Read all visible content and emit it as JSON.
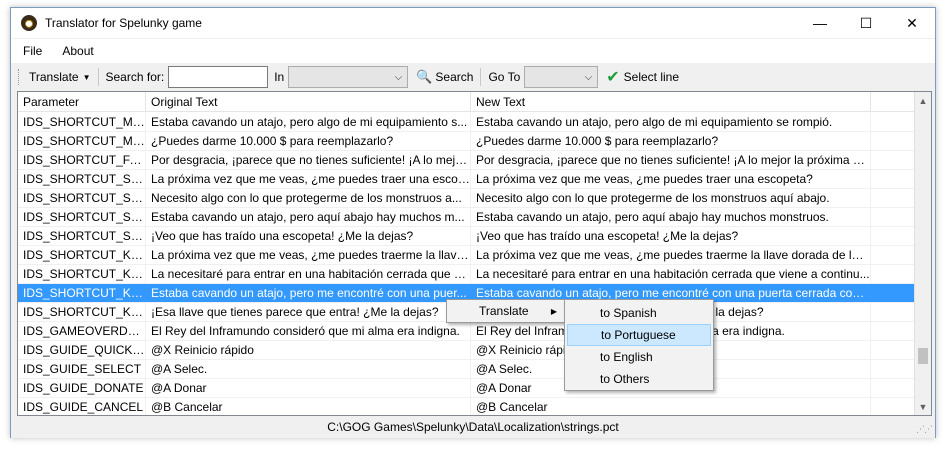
{
  "window": {
    "title": "Translator for Spelunky game"
  },
  "controls": {
    "minimize": "—",
    "maximize": "☐",
    "close": "✕"
  },
  "menu": {
    "file": "File",
    "about": "About"
  },
  "toolbar": {
    "translate_label": "Translate",
    "search_for_label": "Search for:",
    "search_value": "",
    "in_label": "In",
    "in_value": "",
    "search_button": "Search",
    "goto_label": "Go To",
    "goto_value": "",
    "select_line": "Select line"
  },
  "grid": {
    "columns": [
      "Parameter",
      "Original Text",
      "New Text"
    ],
    "rows": [
      {
        "param": "IDS_SHORTCUT_MO...",
        "orig": "Estaba cavando un atajo, pero algo de mi equipamiento s...",
        "new": "Estaba cavando un atajo, pero algo de mi equipamiento se rompió."
      },
      {
        "param": "IDS_SHORTCUT_MO...",
        "orig": "¿Puedes darme 10.000 $ para reemplazarlo?",
        "new": "¿Puedes darme 10.000 $ para reemplazarlo?"
      },
      {
        "param": "IDS_SHORTCUT_FAIL",
        "orig": "Por desgracia, ¡parece que no tienes suficiente! ¡A lo mejo...",
        "new": "Por desgracia, ¡parece que no tienes suficiente! ¡A lo mejor la próxima vez!"
      },
      {
        "param": "IDS_SHORTCUT_SHO...",
        "orig": "La próxima vez que me veas, ¿me puedes traer una escop...",
        "new": "La próxima vez que me veas, ¿me puedes traer una escopeta?"
      },
      {
        "param": "IDS_SHORTCUT_SHO...",
        "orig": "Necesito algo con lo que protegerme de los monstruos a...",
        "new": "Necesito algo con lo que protegerme de los monstruos aquí abajo."
      },
      {
        "param": "IDS_SHORTCUT_SHO...",
        "orig": "Estaba cavando un atajo, pero aquí abajo hay muchos m...",
        "new": "Estaba cavando un atajo, pero aquí abajo hay muchos monstruos."
      },
      {
        "param": "IDS_SHORTCUT_SHO...",
        "orig": "¡Veo que has traído una escopeta! ¿Me la dejas?",
        "new": "¡Veo que has traído una escopeta! ¿Me la dejas?"
      },
      {
        "param": "IDS_SHORTCUT_KEY_...",
        "orig": "La próxima vez que me veas, ¿me puedes traerme la llave dor...",
        "new": "La próxima vez que me veas, ¿me puedes traerme la llave dorada de las Min..."
      },
      {
        "param": "IDS_SHORTCUT_KEY_...",
        "orig": "La necesitaré para entrar en una habitación cerrada que vi...",
        "new": "La necesitaré para entrar en una habitación cerrada que viene a continu..."
      },
      {
        "param": "IDS_SHORTCUT_KEY",
        "orig": "Estaba cavando un atajo, pero me encontré con una puer...",
        "new": "Estaba cavando un atajo, pero me encontré con una puerta cerrada con ...",
        "selected": true
      },
      {
        "param": "IDS_SHORTCUT_KEY_...",
        "orig": "¡Esa llave que tienes parece que entra! ¿Me la dejas?",
        "new": "¡Esa llave que tienes parece que entra! ¿Me la dejas?"
      },
      {
        "param": "IDS_GAMEOVERDESC...",
        "orig": "El Rey del Inframundo consideró que mi alma era indigna.",
        "new": "El Rey del Inframundo consideró que mi alma era indigna."
      },
      {
        "param": "IDS_GUIDE_QUICKRE...",
        "orig": "@X Reinicio rápido",
        "new": "@X Reinicio rápido"
      },
      {
        "param": "IDS_GUIDE_SELECT",
        "orig": "@A Selec.",
        "new": "@A Selec."
      },
      {
        "param": "IDS_GUIDE_DONATE",
        "orig": "@A Donar",
        "new": "@A Donar"
      },
      {
        "param": "IDS_GUIDE_CANCEL",
        "orig": "@B Cancelar",
        "new": "@B Cancelar"
      }
    ]
  },
  "status": {
    "path": "C:\\GOG Games\\Spelunky\\Data\\Localization\\strings.pct"
  },
  "context_menu": {
    "translate": "Translate",
    "submenu": [
      "to Spanish",
      "to Portuguese",
      "to English",
      "to Others"
    ],
    "highlighted_index": 1
  }
}
